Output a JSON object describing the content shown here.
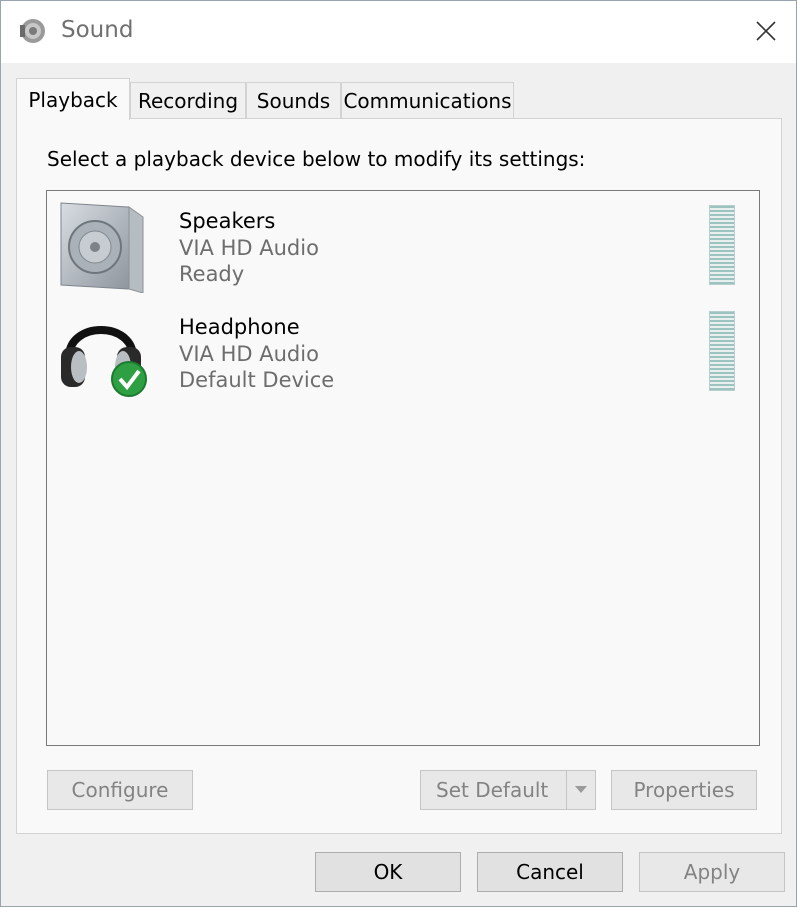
{
  "window": {
    "title": "Sound",
    "close_icon": "close-icon",
    "app_icon": "speaker-settings-icon"
  },
  "tabs": [
    {
      "label": "Playback",
      "active": true
    },
    {
      "label": "Recording",
      "active": false
    },
    {
      "label": "Sounds",
      "active": false
    },
    {
      "label": "Communications",
      "active": false
    }
  ],
  "panel": {
    "instruction": "Select a playback device below to modify its settings:"
  },
  "devices": [
    {
      "name": "Speakers",
      "driver": "VIA HD Audio",
      "status": "Ready",
      "icon": "speaker-icon",
      "is_default": false
    },
    {
      "name": "Headphone",
      "driver": "VIA HD Audio",
      "status": "Default Device",
      "icon": "headphone-icon",
      "is_default": true
    }
  ],
  "buttons": {
    "configure": "Configure",
    "set_default": "Set Default",
    "properties": "Properties",
    "ok": "OK",
    "cancel": "Cancel",
    "apply": "Apply"
  },
  "colors": {
    "check_green": "#2ea043",
    "meter": "#9cc3bf"
  }
}
